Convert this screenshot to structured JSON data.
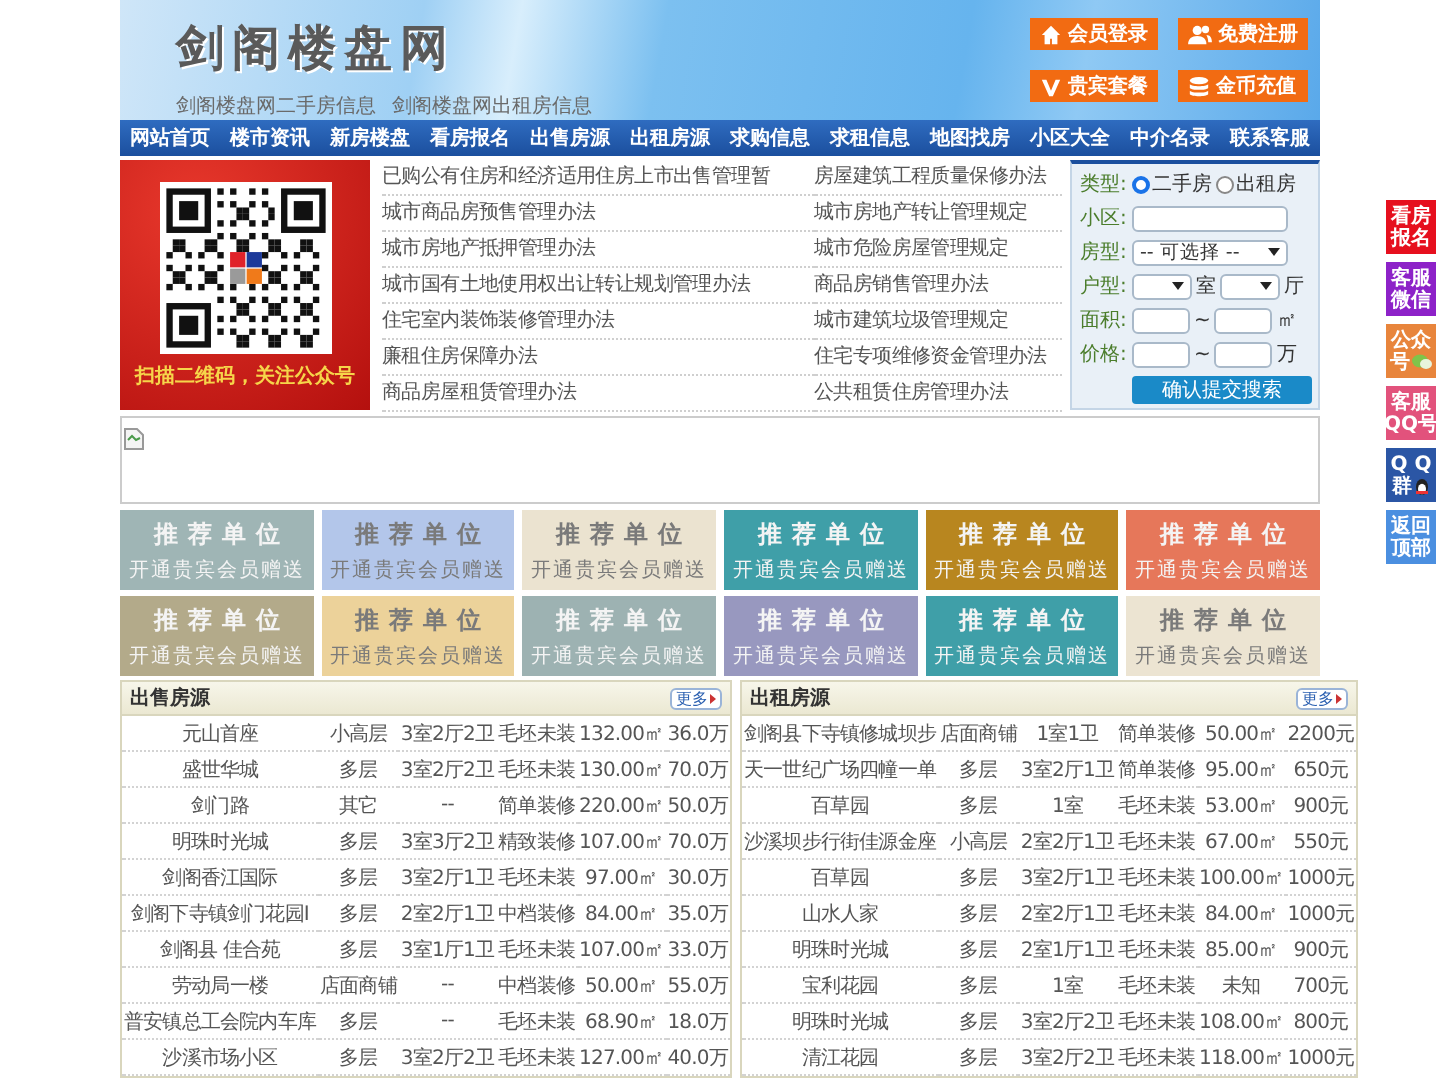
{
  "header": {
    "logo": "剑阁楼盘网",
    "subtitle_links": [
      "剑阁楼盘网二手房信息",
      "剑阁楼盘网出租房信息"
    ],
    "buttons": [
      {
        "label": "会员登录",
        "kind": "home"
      },
      {
        "label": "免费注册",
        "kind": "users"
      },
      {
        "label": "贵宾套餐",
        "kind": "vip"
      },
      {
        "label": "金币充值",
        "kind": "coins"
      }
    ]
  },
  "nav": [
    "网站首页",
    "楼市资讯",
    "新房楼盘",
    "看房报名",
    "出售房源",
    "出租房源",
    "求购信息",
    "求租信息",
    "地图找房",
    "小区大全",
    "中介名录",
    "联系客服"
  ],
  "qr_panel": {
    "caption": "扫描二维码，关注公众号"
  },
  "policy_links": [
    {
      "left": "已购公有住房和经济适用住房上市出售管理暂",
      "right": "房屋建筑工程质量保修办法"
    },
    {
      "left": "城市商品房预售管理办法",
      "right": "城市房地产转让管理规定"
    },
    {
      "left": "城市房地产抵押管理办法",
      "right": "城市危险房屋管理规定"
    },
    {
      "left": "城市国有土地使用权出让转让规划管理办法",
      "right": "商品房销售管理办法"
    },
    {
      "left": "住宅室内装饰装修管理办法",
      "right": "城市建筑垃圾管理规定"
    },
    {
      "left": "廉租住房保障办法",
      "right": "住宅专项维修资金管理办法"
    },
    {
      "left": "商品房屋租赁管理办法",
      "right": "公共租赁住房管理办法"
    }
  ],
  "search": {
    "rows": [
      {
        "label": "类型:",
        "kind": "radio",
        "options": [
          {
            "label": "二手房",
            "selected": true
          },
          {
            "label": "出租房",
            "selected": false
          }
        ]
      },
      {
        "label": "小区:",
        "kind": "text"
      },
      {
        "label": "房型:",
        "kind": "select",
        "value": "-- 可选择 --"
      },
      {
        "label": "户型:",
        "kind": "select-pair",
        "units": [
          "室",
          "厅"
        ]
      },
      {
        "label": "面积:",
        "kind": "range",
        "separator": "~",
        "unit": "㎡"
      },
      {
        "label": "价格:",
        "kind": "range",
        "separator": "~",
        "unit": "万"
      }
    ],
    "submit": "确认提交搜索"
  },
  "banner": {
    "kind": "broken-image"
  },
  "ads": [
    {
      "title": "推荐单位",
      "subtitle": "开通贵宾会员赠送",
      "color": "#9fb5b5"
    },
    {
      "title": "推荐单位",
      "subtitle": "开通贵宾会员赠送",
      "color": "#b3c6ea"
    },
    {
      "title": "推荐单位",
      "subtitle": "开通贵宾会员赠送",
      "color": "#ebe3d0"
    },
    {
      "title": "推荐单位",
      "subtitle": "开通贵宾会员赠送",
      "color": "#3f9fa8"
    },
    {
      "title": "推荐单位",
      "subtitle": "开通贵宾会员赠送",
      "color": "#b8861f"
    },
    {
      "title": "推荐单位",
      "subtitle": "开通贵宾会员赠送",
      "color": "#e6775a"
    },
    {
      "title": "推荐单位",
      "subtitle": "开通贵宾会员赠送",
      "color": "#b3aa8a"
    },
    {
      "title": "推荐单位",
      "subtitle": "开通贵宾会员赠送",
      "color": "#ecd29a"
    },
    {
      "title": "推荐单位",
      "subtitle": "开通贵宾会员赠送",
      "color": "#9db2b2"
    },
    {
      "title": "推荐单位",
      "subtitle": "开通贵宾会员赠送",
      "color": "#9898bf"
    },
    {
      "title": "推荐单位",
      "subtitle": "开通贵宾会员赠送",
      "color": "#3f9fa8"
    },
    {
      "title": "推荐单位",
      "subtitle": "开通贵宾会员赠送",
      "color": "#ece4d2"
    }
  ],
  "listings": [
    {
      "title": "出售房源",
      "more": "更多",
      "rows": [
        [
          "元山首座",
          "小高层",
          "3室2厅2卫",
          "毛坯未装",
          "132.00㎡",
          "36.0万"
        ],
        [
          "盛世华城",
          "多层",
          "3室2厅2卫",
          "毛坯未装",
          "130.00㎡",
          "70.0万"
        ],
        [
          "剑门路",
          "其它",
          "--",
          "简单装修",
          "220.00㎡",
          "50.0万"
        ],
        [
          "明珠时光城",
          "多层",
          "3室3厅2卫",
          "精致装修",
          "107.00㎡",
          "70.0万"
        ],
        [
          "剑阁香江国际",
          "多层",
          "3室2厅1卫",
          "毛坯未装",
          "97.00㎡",
          "30.0万"
        ],
        [
          "剑阁下寺镇剑门花园I",
          "多层",
          "2室2厅1卫",
          "中档装修",
          "84.00㎡",
          "35.0万"
        ],
        [
          "剑阁县 佳合苑",
          "多层",
          "3室1厅1卫",
          "毛坯未装",
          "107.00㎡",
          "33.0万"
        ],
        [
          "劳动局一楼",
          "店面商铺",
          "--",
          "中档装修",
          "50.00㎡",
          "55.0万"
        ],
        [
          "普安镇总工会院内车库",
          "多层",
          "--",
          "毛坯未装",
          "68.90㎡",
          "18.0万"
        ],
        [
          "沙溪市场小区",
          "多层",
          "3室2厅2卫",
          "毛坯未装",
          "127.00㎡",
          "40.0万"
        ]
      ]
    },
    {
      "title": "出租房源",
      "more": "更多",
      "rows": [
        [
          "剑阁县下寺镇修城坝步",
          "店面商铺",
          "1室1卫",
          "简单装修",
          "50.00㎡",
          "2200元"
        ],
        [
          "天一世纪广场四幢一单",
          "多层",
          "3室2厅1卫",
          "简单装修",
          "95.00㎡",
          "650元"
        ],
        [
          "百草园",
          "多层",
          "1室",
          "毛坯未装",
          "53.00㎡",
          "900元"
        ],
        [
          "沙溪坝步行街佳源金座",
          "小高层",
          "2室2厅1卫",
          "毛坯未装",
          "67.00㎡",
          "550元"
        ],
        [
          "百草园",
          "多层",
          "3室2厅1卫",
          "毛坯未装",
          "100.00㎡",
          "1000元"
        ],
        [
          "山水人家",
          "多层",
          "2室2厅1卫",
          "毛坯未装",
          "84.00㎡",
          "1000元"
        ],
        [
          "明珠时光城",
          "多层",
          "2室1厅1卫",
          "毛坯未装",
          "85.00㎡",
          "900元"
        ],
        [
          "宝利花园",
          "多层",
          "1室",
          "毛坯未装",
          "未知",
          "700元"
        ],
        [
          "明珠时光城",
          "多层",
          "3室2厅2卫",
          "毛坯未装",
          "108.00㎡",
          "800元"
        ],
        [
          "清江花园",
          "多层",
          "3室2厅2卫",
          "毛坯未装",
          "118.00㎡",
          "1000元"
        ]
      ]
    }
  ],
  "side_buttons": [
    {
      "lines": [
        "看房",
        "报名"
      ],
      "kind": "plain",
      "color": "#e60f1e"
    },
    {
      "lines": [
        "客服",
        "微信"
      ],
      "kind": "plain",
      "color": "#8d22c8"
    },
    {
      "lines": [
        "公众",
        "号"
      ],
      "kind": "wechat",
      "color": "#e8853c"
    },
    {
      "lines": [
        "客服",
        "QQ号"
      ],
      "kind": "plain",
      "color": "#e2527c"
    },
    {
      "lines": [
        "Q Q",
        "群"
      ],
      "kind": "qq",
      "color": "#2b56a5"
    },
    {
      "lines": [
        "返回",
        "顶部"
      ],
      "kind": "plain",
      "color": "#4b8fe0"
    }
  ]
}
